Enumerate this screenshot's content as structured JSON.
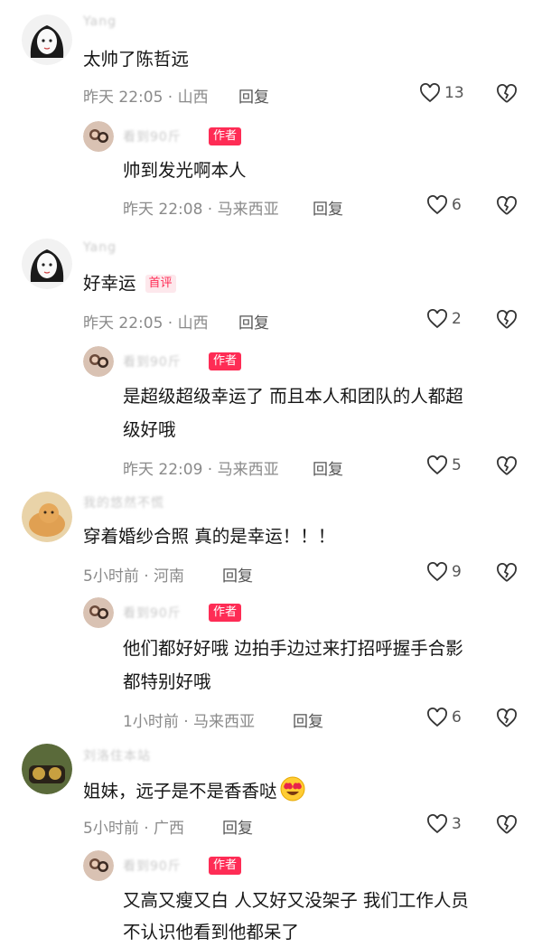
{
  "comments": [
    {
      "name": "Yang",
      "text": "太帅了陈哲远",
      "meta": "昨天 22:05 · 山西",
      "reply": "回复",
      "likes": "13",
      "author_reply": {
        "name": "看到90斤",
        "badge": "作者",
        "text1": "帅到发光啊本人",
        "text2": "",
        "meta": "昨天 22:08 · 马来西亚",
        "reply": "回复",
        "likes": "6"
      }
    },
    {
      "name": "Yang",
      "text": "好幸运",
      "first_badge": "首评",
      "meta": "昨天 22:05 · 山西",
      "reply": "回复",
      "likes": "2",
      "author_reply": {
        "name": "看到90斤",
        "badge": "作者",
        "text1": "是超级超级幸运了 而且本人和团队的人都超",
        "text2": "级好哦",
        "meta": "昨天 22:09 · 马来西亚",
        "reply": "回复",
        "likes": "5"
      }
    },
    {
      "name": "我的悠然不慌",
      "text": "穿着婚纱合照 真的是幸运！！！",
      "meta": "5小时前 · 河南",
      "reply": "回复",
      "likes": "9",
      "author_reply": {
        "name": "看到90斤",
        "badge": "作者",
        "text1": "他们都好好哦 边拍手边过来打招呼握手合影",
        "text2": "都特别好哦",
        "meta": "1小时前 · 马来西亚",
        "reply": "回复",
        "likes": "6"
      }
    },
    {
      "name": "刘洛住本站",
      "text": "姐妹，远子是不是香香哒",
      "meta": "5小时前 · 广西",
      "reply": "回复",
      "likes": "3",
      "author_reply": {
        "name": "看到90斤",
        "badge": "作者",
        "text1": "又高又瘦又白 人又好又没架子 我们工作人员",
        "text2": "不认识他看到他都呆了",
        "meta": "",
        "reply": "",
        "likes": ""
      }
    }
  ],
  "icons": {
    "like": "heart-outline-icon",
    "dislike": "broken-heart-icon",
    "emoji": "heart-eyes-emoji-icon"
  },
  "colors": {
    "badge": "#fe2c55",
    "meta": "#8a8a8a",
    "text": "#161616"
  }
}
